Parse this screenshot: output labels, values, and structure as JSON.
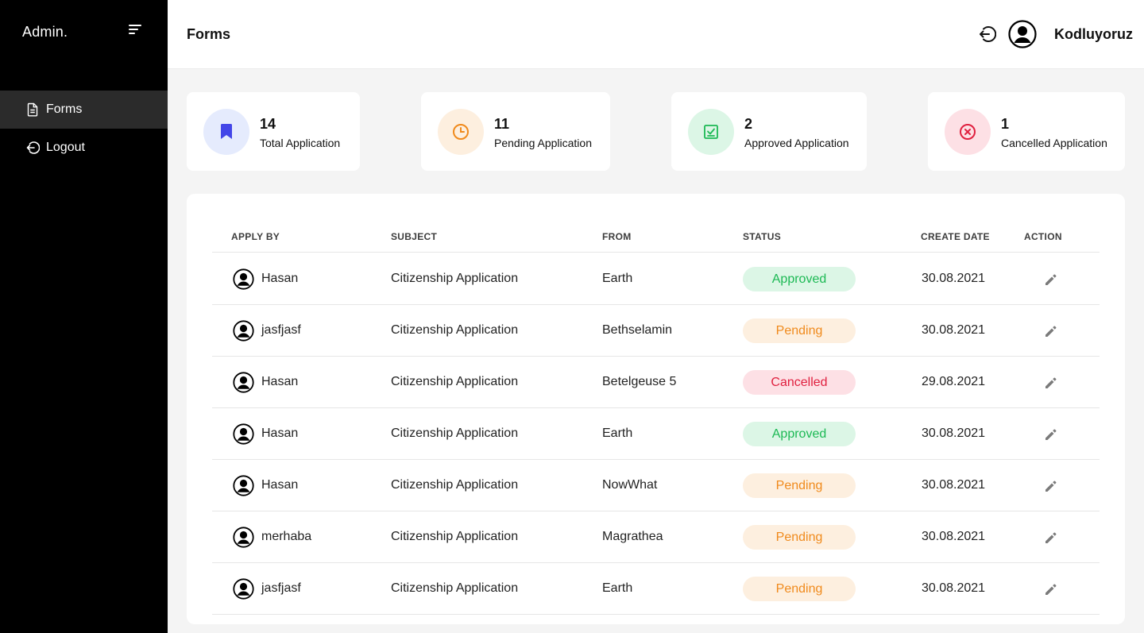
{
  "sidebar": {
    "brand": "Admin.",
    "items": [
      {
        "label": "Forms",
        "icon": "document-icon",
        "active": true
      },
      {
        "label": "Logout",
        "icon": "logout-icon",
        "active": false
      }
    ]
  },
  "header": {
    "title": "Forms",
    "username": "Kodluyoruz"
  },
  "stats": [
    {
      "value": "14",
      "label": "Total Application",
      "icon": "bookmark-icon",
      "bg": "#e5ebfd",
      "fg": "#4346e8"
    },
    {
      "value": "11",
      "label": "Pending Application",
      "icon": "clock-icon",
      "bg": "#fdefdf",
      "fg": "#f08a1c"
    },
    {
      "value": "2",
      "label": "Approved Application",
      "icon": "check-square-icon",
      "bg": "#dcf6e6",
      "fg": "#1cb954"
    },
    {
      "value": "1",
      "label": "Cancelled Application",
      "icon": "x-circle-icon",
      "bg": "#fde0e5",
      "fg": "#e0203f"
    }
  ],
  "table": {
    "columns": [
      "APPLY BY",
      "SUBJECT",
      "FROM",
      "STATUS",
      "CREATE DATE",
      "ACTION"
    ],
    "rows": [
      {
        "apply_by": "Hasan",
        "subject": "Citizenship Application",
        "from": "Earth",
        "status": "Approved",
        "date": "30.08.2021"
      },
      {
        "apply_by": "jasfjasf",
        "subject": "Citizenship Application",
        "from": "Bethselamin",
        "status": "Pending",
        "date": "30.08.2021"
      },
      {
        "apply_by": "Hasan",
        "subject": "Citizenship Application",
        "from": "Betelgeuse 5",
        "status": "Cancelled",
        "date": "29.08.2021"
      },
      {
        "apply_by": "Hasan",
        "subject": "Citizenship Application",
        "from": "Earth",
        "status": "Approved",
        "date": "30.08.2021"
      },
      {
        "apply_by": "Hasan",
        "subject": "Citizenship Application",
        "from": "NowWhat",
        "status": "Pending",
        "date": "30.08.2021"
      },
      {
        "apply_by": "merhaba",
        "subject": "Citizenship Application",
        "from": "Magrathea",
        "status": "Pending",
        "date": "30.08.2021"
      },
      {
        "apply_by": "jasfjasf",
        "subject": "Citizenship Application",
        "from": "Earth",
        "status": "Pending",
        "date": "30.08.2021"
      }
    ]
  },
  "colors": {
    "sidebar_bg": "#000000",
    "active_item_bg": "#2b2b2b",
    "approved": "#1cb954",
    "pending": "#f08a1c",
    "cancelled": "#e0203f"
  }
}
